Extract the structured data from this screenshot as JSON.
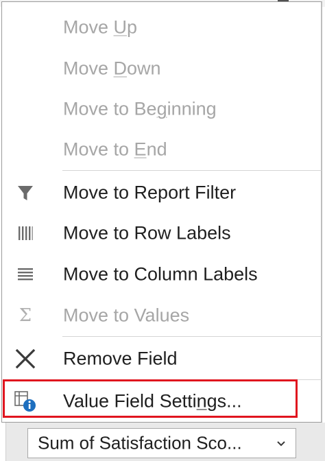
{
  "menu": {
    "items": [
      {
        "id": "move-up",
        "pre": "Move ",
        "u": "U",
        "post": "p",
        "disabled": true
      },
      {
        "id": "move-down",
        "pre": "Move ",
        "u": "D",
        "post": "own",
        "disabled": true
      },
      {
        "id": "move-to-beginning",
        "pre": "Move to Be",
        "u": "g",
        "post": "inning",
        "disabled": true
      },
      {
        "id": "move-to-end",
        "pre": "Move to ",
        "u": "E",
        "post": "nd",
        "disabled": true
      },
      {
        "id": "move-to-report-filter",
        "label": "Move to Report Filter",
        "icon": "filter-icon",
        "disabled": false
      },
      {
        "id": "move-to-row-labels",
        "label": "Move to Row Labels",
        "icon": "row-labels-icon",
        "disabled": false
      },
      {
        "id": "move-to-column-labels",
        "label": "Move to Column Labels",
        "icon": "column-labels-icon",
        "disabled": false
      },
      {
        "id": "move-to-values",
        "label": "Move to Values",
        "icon": "sigma-icon",
        "icon_text": "Σ",
        "disabled": true
      },
      {
        "id": "remove-field",
        "label": "Remove Field",
        "icon": "remove-x-icon",
        "disabled": false
      },
      {
        "id": "value-field-settings",
        "pre": "Value Field Setti",
        "u": "n",
        "post": "gs...",
        "icon": "field-settings-info-icon",
        "disabled": false,
        "highlighted": true
      }
    ]
  },
  "field_button": {
    "label": "Sum of Satisfaction Sco...",
    "icon": "chevron-down-icon"
  },
  "colors": {
    "enabled_text": "#1f1f1f",
    "disabled_text": "#a6a6a6",
    "highlight_border": "#e0141e",
    "info_blue": "#1e6fbf"
  }
}
